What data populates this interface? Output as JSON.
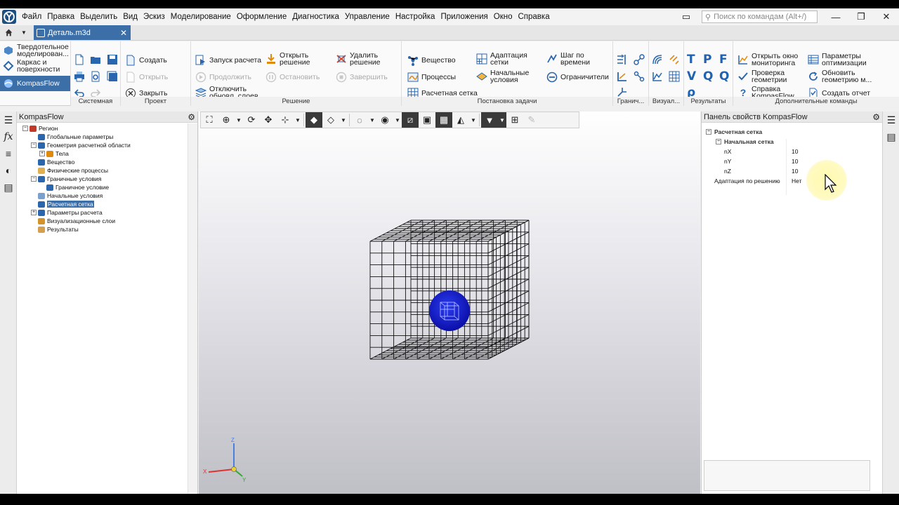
{
  "menu": {
    "items": [
      "Файл",
      "Правка",
      "Выделить",
      "Вид",
      "Эскиз",
      "Моделирование",
      "Оформление",
      "Диагностика",
      "Управление",
      "Настройка",
      "Приложения",
      "Окно",
      "Справка"
    ],
    "search_placeholder": "Поиск по командам (Alt+/)"
  },
  "tabs": {
    "document": "Деталь.m3d"
  },
  "ribbon": {
    "modes": {
      "solid": "Твердотельное моделирован...",
      "wireframe_line1": "Каркас и",
      "wireframe_line2": "поверхности",
      "kompasflow": "KompasFlow"
    },
    "groups": {
      "system": "Системная",
      "project": "Проект",
      "solution": "Решение",
      "setup": "Постановка задачи",
      "boundary": "Гранич...",
      "visual": "Визуал...",
      "results": "Результаты",
      "extra": "Дополнительные команды"
    },
    "project": {
      "create": "Создать",
      "open": "Открыть",
      "close": "Закрыть"
    },
    "solution": {
      "run": "Запуск расчета",
      "open_solution_1": "Открыть",
      "open_solution_2": "решение",
      "delete_solution_1": "Удалить",
      "delete_solution_2": "решение",
      "continue": "Продолжить",
      "stop": "Остановить",
      "finish": "Завершить",
      "disable_layers_1": "Отключить",
      "disable_layers_2": "обновл. слоев"
    },
    "setup": {
      "substance": "Вещество",
      "processes": "Процессы",
      "mesh": "Расчетная сетка",
      "mesh_adapt_1": "Адаптация",
      "mesh_adapt_2": "сетки",
      "initial_1": "Начальные",
      "initial_2": "условия",
      "time_step_1": "Шаг по",
      "time_step_2": "времени",
      "limiters": "Ограничители"
    },
    "results_glyphs": [
      "T",
      "P",
      "F",
      "V",
      "Q",
      "Q",
      "ρ"
    ],
    "extra": {
      "monitor_1": "Открыть окно",
      "monitor_2": "мониторинга",
      "check_geom_1": "Проверка",
      "check_geom_2": "геометрии",
      "help_1": "Справка",
      "help_2": "KompasFlow",
      "opt_params_1": "Параметры",
      "opt_params_2": "оптимизации",
      "update_geom_1": "Обновить",
      "update_geom_2": "геометрию м...",
      "report": "Создать отчет"
    }
  },
  "tree_panel": {
    "title": "KompasFlow",
    "nodes": [
      {
        "label": "Регион",
        "level": 0,
        "expander": "−",
        "selected": false
      },
      {
        "label": "Глобальные параметры",
        "level": 1,
        "expander": "",
        "selected": false
      },
      {
        "label": "Геометрия расчетной области",
        "level": 1,
        "expander": "−",
        "selected": false
      },
      {
        "label": "Тела",
        "level": 2,
        "expander": "+",
        "selected": false
      },
      {
        "label": "Вещество",
        "level": 1,
        "expander": "",
        "selected": false
      },
      {
        "label": "Физические процессы",
        "level": 1,
        "expander": "",
        "selected": false
      },
      {
        "label": "Граничные условия",
        "level": 1,
        "expander": "−",
        "selected": false
      },
      {
        "label": "Граничное условие",
        "level": 2,
        "expander": "",
        "selected": false
      },
      {
        "label": "Начальные условия",
        "level": 1,
        "expander": "",
        "selected": false
      },
      {
        "label": "Расчетная сетка",
        "level": 1,
        "expander": "",
        "selected": true
      },
      {
        "label": "Параметры расчета",
        "level": 1,
        "expander": "+",
        "selected": false
      },
      {
        "label": "Визуализационные слои",
        "level": 1,
        "expander": "",
        "selected": false
      },
      {
        "label": "Результаты",
        "level": 1,
        "expander": "",
        "selected": false
      }
    ]
  },
  "props_panel": {
    "title": "Панель свойств KompasFlow",
    "section": "Расчетная сетка",
    "subsection": "Начальная сетка",
    "rows": [
      {
        "name": "nX",
        "value": "10"
      },
      {
        "name": "nY",
        "value": "10"
      },
      {
        "name": "nZ",
        "value": "10"
      }
    ],
    "adapt": {
      "name": "Адаптация по решению",
      "value": "Нет"
    }
  },
  "viewport": {
    "axes": {
      "x": "X",
      "y": "Y",
      "z": "Z"
    },
    "mesh_divisions": 10,
    "body_color": "#1515c8"
  },
  "colors": {
    "accent": "#3c6ea8",
    "ribbon_icon": "#1f63b0"
  }
}
